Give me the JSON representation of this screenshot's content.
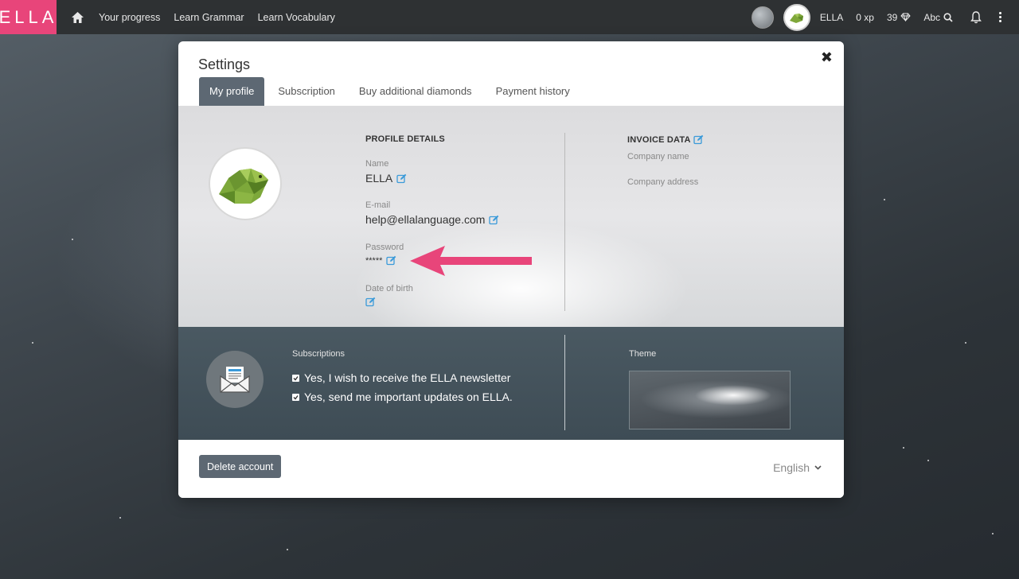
{
  "topbar": {
    "logo": "ELLA",
    "nav": [
      "Your progress",
      "Learn Grammar",
      "Learn Vocabulary"
    ],
    "username": "ELLA",
    "xp": "0 xp",
    "diamonds": "39",
    "abc": "Abc"
  },
  "modal": {
    "title": "Settings",
    "tabs": [
      "My profile",
      "Subscription",
      "Buy additional diamonds",
      "Payment history"
    ],
    "profile": {
      "heading": "PROFILE DETAILS",
      "name_label": "Name",
      "name_value": "ELLA",
      "email_label": "E-mail",
      "email_value": "help@ellalanguage.com",
      "password_label": "Password",
      "password_value": "*****",
      "dob_label": "Date of birth"
    },
    "invoice": {
      "heading": "INVOICE DATA",
      "company_name": "Company name",
      "company_address": "Company address"
    },
    "subscriptions": {
      "label": "Subscriptions",
      "newsletter": "Yes, I wish to receive the ELLA newsletter",
      "updates": "Yes, send me important updates on ELLA."
    },
    "theme_label": "Theme",
    "delete_button": "Delete account",
    "language": "English"
  },
  "colors": {
    "brand": "#e8457a",
    "tab_active": "#5d6873",
    "edit_icon": "#3a9ad9",
    "arrow": "#e8457a"
  }
}
